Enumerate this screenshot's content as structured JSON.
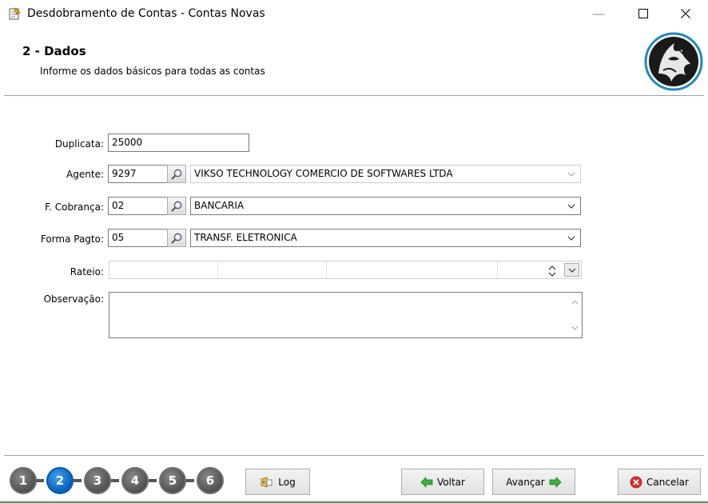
{
  "window": {
    "title": "Desdobramento de Contas - Contas Novas",
    "min_glyph": "—",
    "max_glyph": "☐",
    "close_glyph": "✕"
  },
  "header": {
    "step_title": "2 - Dados",
    "step_subtitle": "Informe os dados básicos para todas as contas",
    "logo_icon": "wolf-logo-icon"
  },
  "form": {
    "duplicata": {
      "label": "Duplicata:",
      "value": "25000"
    },
    "agente": {
      "label": "Agente:",
      "code": "9297",
      "name": "VIKSO TECHNOLOGY COMERCIO DE SOFTWARES LTDA"
    },
    "forma_cobranca": {
      "label": "F. Cobrança:",
      "code": "02",
      "name": "BANCARIA"
    },
    "forma_pagto": {
      "label": "Forma Pagto:",
      "code": "05",
      "name": "TRANSF. ELETRONICA"
    },
    "rateio": {
      "label": "Rateio:",
      "value": ""
    },
    "observacao": {
      "label": "Observação:",
      "value": ""
    }
  },
  "footer": {
    "steps": [
      "1",
      "2",
      "3",
      "4",
      "5",
      "6"
    ],
    "active_step": "2",
    "log_label": "Log",
    "voltar_label": "Voltar",
    "avancar_label": "Avançar",
    "cancelar_label": "Cancelar"
  },
  "colors": {
    "active_step": "#1a73c8",
    "inactive_step": "#5a5a5a",
    "arrow_green": "#2e9e2e",
    "cancel_red": "#d32f2f"
  }
}
